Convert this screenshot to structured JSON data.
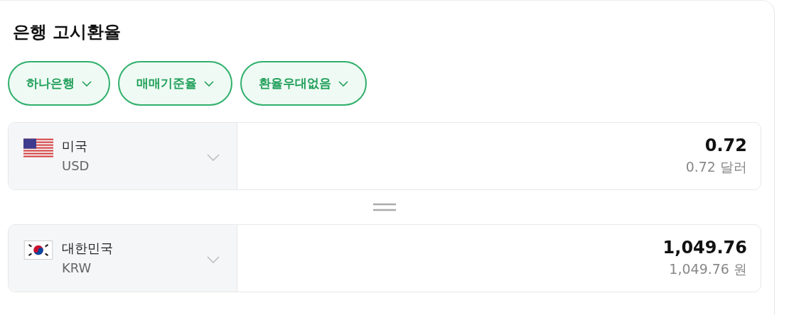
{
  "title": "은행 고시환율",
  "filters": [
    {
      "label": "하나은행"
    },
    {
      "label": "매매기준율"
    },
    {
      "label": "환율우대없음"
    }
  ],
  "currencies": [
    {
      "kind": "us",
      "country": "미국",
      "code": "USD",
      "amount": "0.72",
      "amount_text": "0.72 달러"
    },
    {
      "kind": "kr",
      "country": "대한민국",
      "code": "KRW",
      "amount": "1,049.76",
      "amount_text": "1,049.76 원"
    }
  ]
}
